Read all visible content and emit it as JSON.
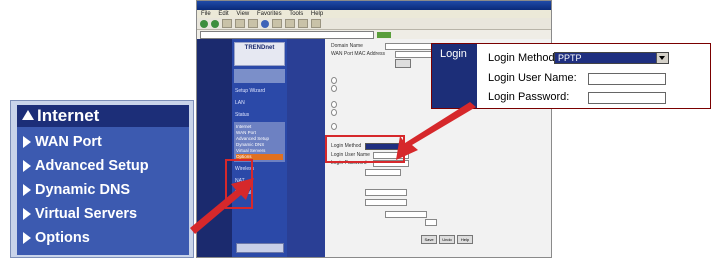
{
  "browser": {
    "menu": [
      "File",
      "Edit",
      "View",
      "Favorites",
      "Tools",
      "Help"
    ],
    "logo": "TRENDnet",
    "nav_items": [
      "Setup Wizard",
      "LAN",
      "Status",
      "Internet",
      "Wireless",
      "NAT",
      "Firewall"
    ],
    "form": {
      "domain_name_label": "Domain Name",
      "wan_mac_label": "WAN Port MAC Address",
      "login_method_label": "Login Method",
      "login_user_label": "Login User Name",
      "login_password_label": "Login Password"
    },
    "buttons": [
      "Save",
      "Undo",
      "Help"
    ]
  },
  "internet_menu": {
    "header": "Internet",
    "items": [
      "WAN Port",
      "Advanced Setup",
      "Dynamic DNS",
      "Virtual Servers",
      "Options"
    ]
  },
  "login": {
    "title": "Login",
    "method_label": "Login Method:",
    "method_value": "PPTP",
    "user_label": "Login User Name:",
    "password_label": "Login Password:"
  },
  "colors": {
    "accent_navy": "#1c2e78",
    "menu_blue": "#3c5ab0",
    "arrow_red": "#d6282b"
  }
}
